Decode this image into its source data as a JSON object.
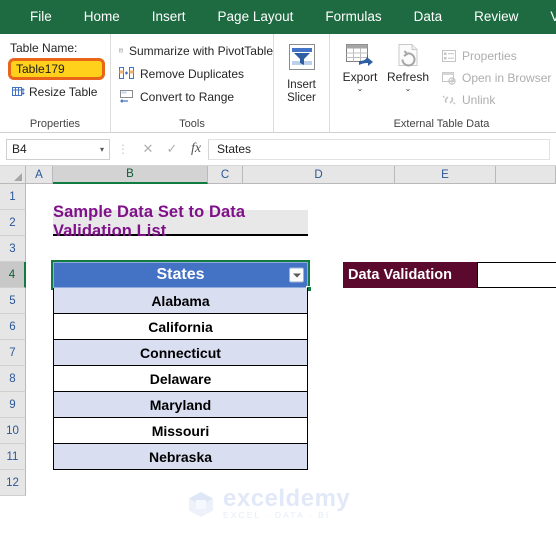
{
  "ribbon_tabs": [
    {
      "label": "File"
    },
    {
      "label": "Home"
    },
    {
      "label": "Insert"
    },
    {
      "label": "Page Layout"
    },
    {
      "label": "Formulas"
    },
    {
      "label": "Data"
    },
    {
      "label": "Review"
    },
    {
      "label": "View"
    }
  ],
  "ribbon": {
    "properties": {
      "group_label": "Properties",
      "table_name_label": "Table Name:",
      "table_name_value": "Table179",
      "resize_table_label": "Resize Table",
      "resize_table_icon": "resize-table-icon",
      "highlight_fill": "#ffd11a",
      "highlight_border": "#e8651a"
    },
    "tools": {
      "group_label": "Tools",
      "items": [
        {
          "label": "Summarize with PivotTable",
          "icon": "pivot-table-icon"
        },
        {
          "label": "Remove Duplicates",
          "icon": "remove-duplicates-icon"
        },
        {
          "label": "Convert to Range",
          "icon": "convert-to-range-icon"
        }
      ]
    },
    "slicer": {
      "label_line1": "Insert",
      "label_line2": "Slicer",
      "icon": "insert-slicer-icon"
    },
    "external": {
      "group_label": "External Table Data",
      "export_label": "Export",
      "export_icon": "export-icon",
      "refresh_label": "Refresh",
      "refresh_icon": "refresh-icon",
      "caret": "⌄",
      "items": [
        {
          "label": "Properties",
          "icon": "properties-icon"
        },
        {
          "label": "Open in Browser",
          "icon": "open-in-browser-icon"
        },
        {
          "label": "Unlink",
          "icon": "unlink-icon"
        }
      ]
    }
  },
  "formula_bar": {
    "name_box_value": "B4",
    "name_box_caret": "▾",
    "cancel_icon": "close-icon",
    "confirm_icon": "check-icon",
    "function_icon": "fx",
    "formula_value": "States"
  },
  "grid": {
    "columns": [
      {
        "label": "A",
        "selected": false
      },
      {
        "label": "B",
        "selected": true
      },
      {
        "label": "C",
        "selected": false
      },
      {
        "label": "D",
        "selected": false
      },
      {
        "label": "E",
        "selected": false
      }
    ],
    "rows": [
      {
        "label": "1",
        "selected": false
      },
      {
        "label": "2",
        "selected": false
      },
      {
        "label": "3",
        "selected": false
      },
      {
        "label": "4",
        "selected": true
      },
      {
        "label": "5",
        "selected": false
      },
      {
        "label": "6",
        "selected": false
      },
      {
        "label": "7",
        "selected": false
      },
      {
        "label": "8",
        "selected": false
      },
      {
        "label": "9",
        "selected": false
      },
      {
        "label": "10",
        "selected": false
      },
      {
        "label": "11",
        "selected": false
      },
      {
        "label": "12",
        "selected": false
      }
    ],
    "title": "Sample Data Set to Data Validation List",
    "title_color": "#80108a",
    "table_header": "States",
    "table_header_fill": "#4472c4",
    "filter_icon": "filter-dropdown-icon",
    "states": [
      "Alabama",
      "California",
      "Connecticut",
      "Delaware",
      "Maryland",
      "Missouri",
      "Nebraska"
    ],
    "data_validation_label": "Data Validation",
    "data_validation_fill": "#5b0a2e",
    "data_validation_value": ""
  },
  "watermark": {
    "name": "exceldemy",
    "tagline": "EXCEL · DATA · BI",
    "icon": "exceldemy-logo-icon"
  }
}
